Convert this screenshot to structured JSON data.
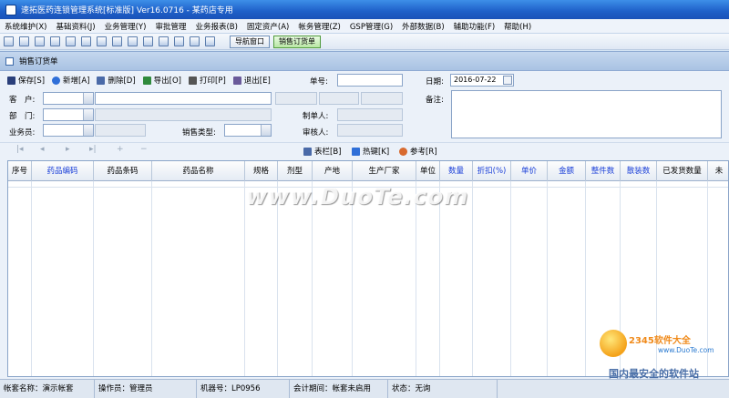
{
  "window": {
    "title": "速拓医药连锁管理系统[标准版] Ver16.0716 - 某药店专用"
  },
  "menu": [
    "系统维护(X)",
    "基础资料(J)",
    "业务管理(Y)",
    "审批管理",
    "业务报表(B)",
    "固定资产(A)",
    "帐务管理(Z)",
    "GSP管理(G)",
    "外部数据(B)",
    "辅助功能(F)",
    "帮助(H)"
  ],
  "toolbar": {
    "nav_window": "导航窗口",
    "sales_order": "销售订货单"
  },
  "subwindow": {
    "title": "销售订货单"
  },
  "actions": {
    "save": "保存[S]",
    "add": "新增[A]",
    "delete": "删除[D]",
    "export": "导出[O]",
    "print": "打印[P]",
    "exit": "退出[E]"
  },
  "form": {
    "order_no_label": "单号:",
    "date_label": "日期:",
    "date_value": "2016-07-22",
    "remark_label": "备注:",
    "customer_label": "客　户:",
    "dept_label": "部　门:",
    "maker_label": "制单人:",
    "salesperson_label": "业务员:",
    "sales_type_label": "销售类型:",
    "auditor_label": "审核人:"
  },
  "grid_tools": {
    "columns": "表栏[B]",
    "hotkey": "热键[K]",
    "reference": "参考[R]"
  },
  "grid": {
    "columns": [
      "序号",
      "药品编码",
      "药品条码",
      "药品名称",
      "规格",
      "剂型",
      "产地",
      "生产厂家",
      "单位",
      "数量",
      "折扣(%)",
      "单价",
      "金额",
      "整件数",
      "散装数",
      "已发货数量",
      "未"
    ]
  },
  "statusbar": {
    "account": "帐套名称：演示帐套",
    "operator": "操作员：管理员",
    "machine": "机器号：LP0956",
    "period": "会计期间：帐套未启用",
    "state": "状态：无询"
  },
  "watermarks": {
    "duote": "www.DuoTe.com",
    "brand": "2345软件大全",
    "brand_url": "www.DuoTe.com",
    "brand_slogan": "国内最安全的软件站"
  },
  "colors": {
    "title_bar": "#1e5fc8",
    "blue_header": "#1a3fd8",
    "background": "#ebf1f9"
  }
}
